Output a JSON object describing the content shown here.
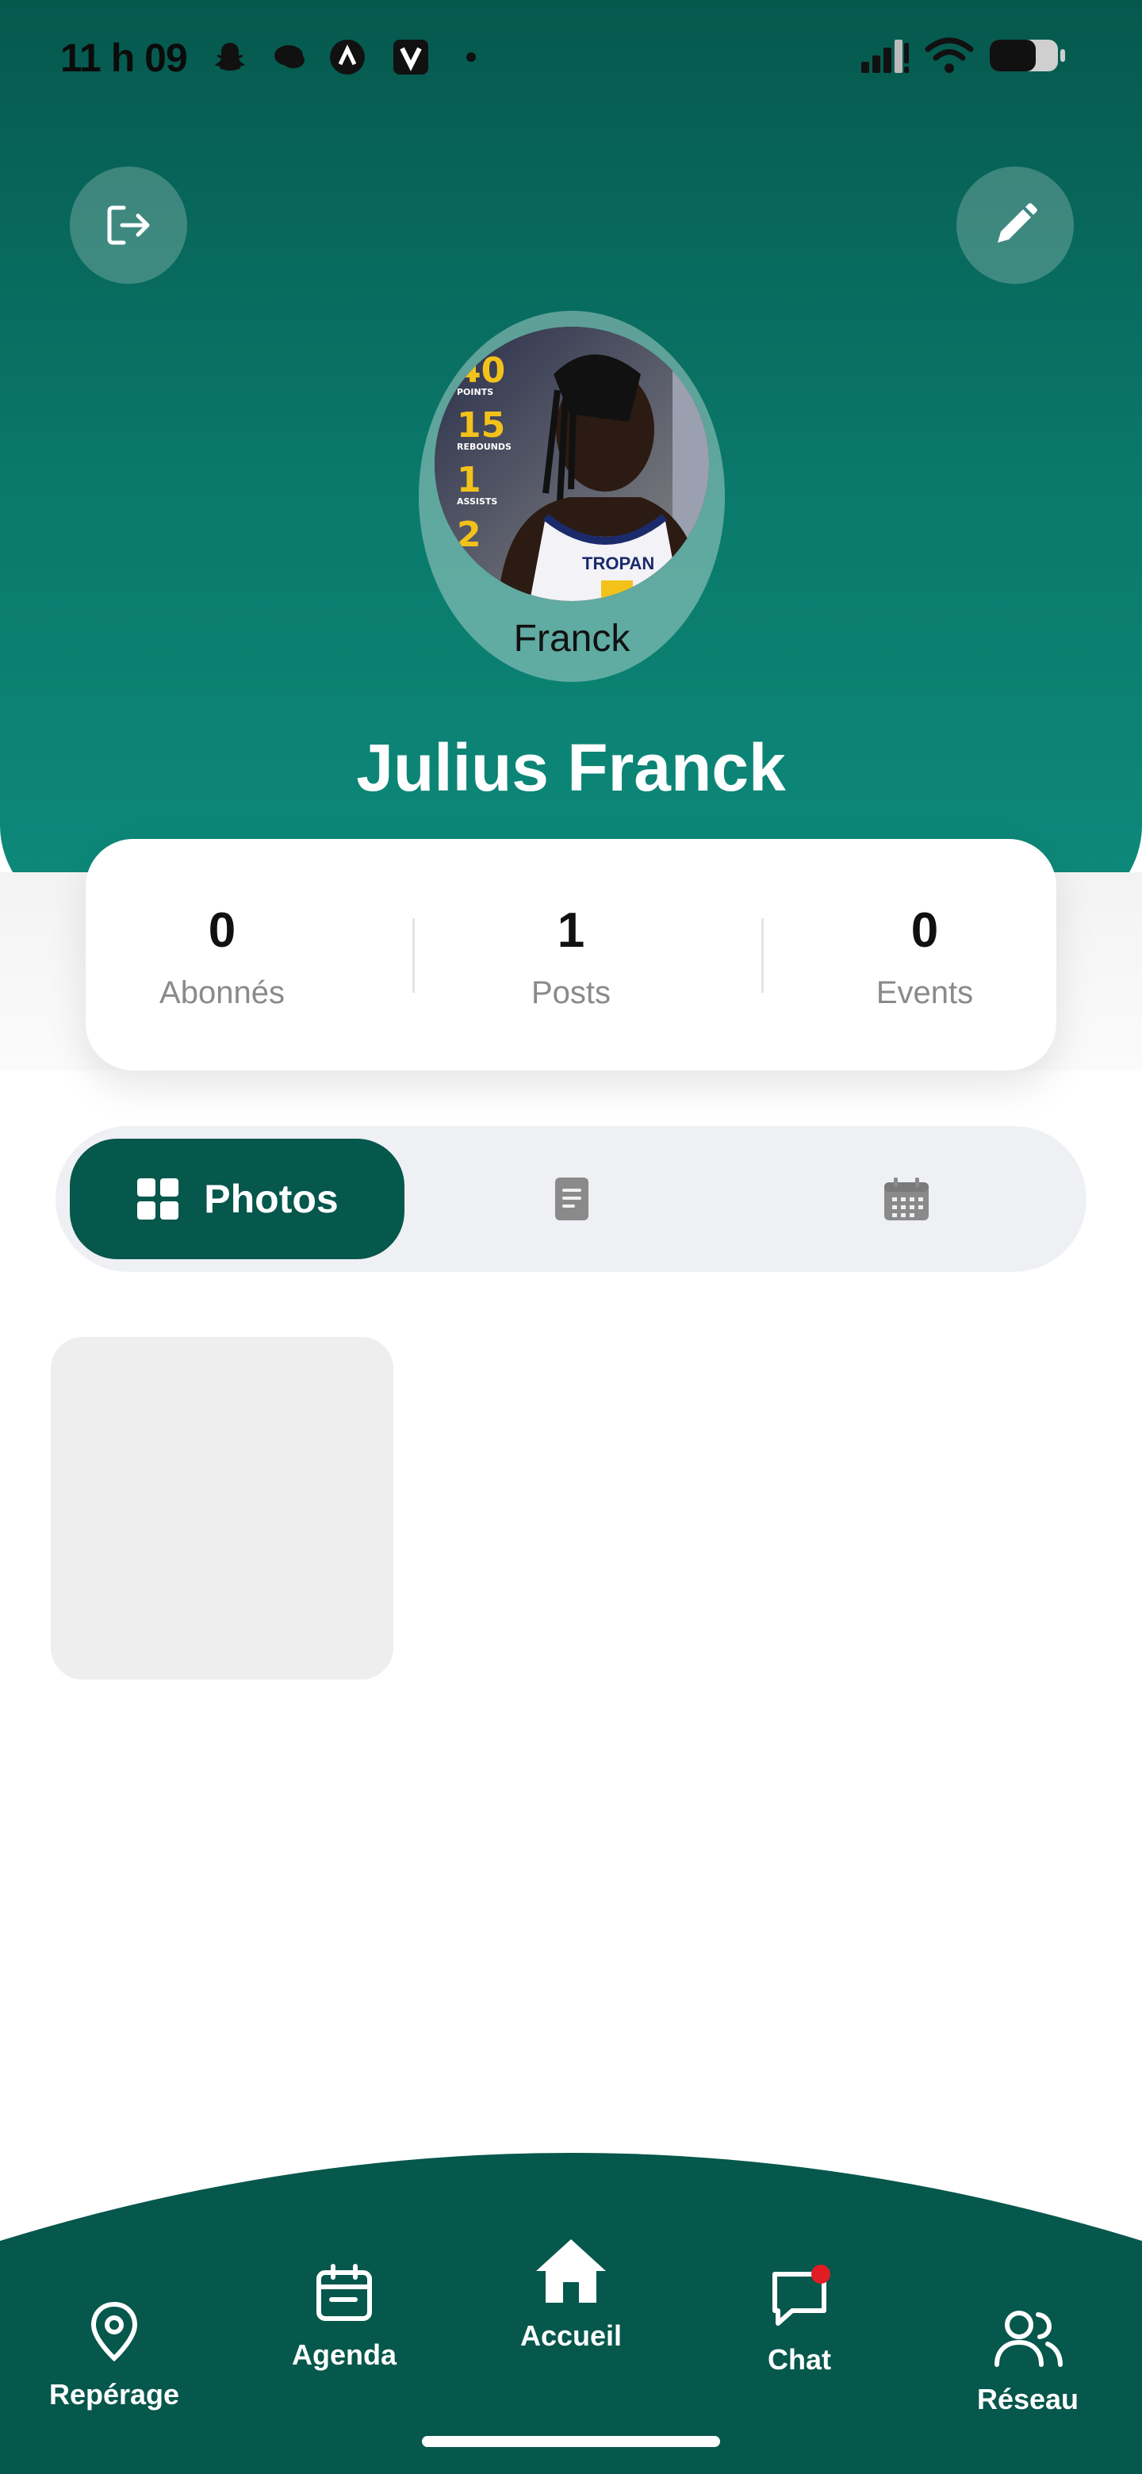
{
  "status_bar": {
    "time": "11 h 09"
  },
  "header": {
    "logout_icon": "logout-icon",
    "edit_icon": "edit-pencil-icon",
    "avatar_caption": "Franck",
    "profile_name": "Julius Franck",
    "avatar_card_stats": [
      "40",
      "15",
      "1",
      "2"
    ],
    "avatar_card_stat_labels": [
      "POINTS",
      "REBOUNDS",
      "ASSISTS"
    ],
    "jersey_text": "TROPAN"
  },
  "stats": [
    {
      "value": "0",
      "label": "Abonnés"
    },
    {
      "value": "1",
      "label": "Posts"
    },
    {
      "value": "0",
      "label": "Events"
    }
  ],
  "tabs": {
    "active_label": "Photos",
    "items": [
      "grid-icon",
      "document-icon",
      "calendar-icon"
    ]
  },
  "bottom_nav": {
    "items": [
      {
        "label": "Repérage",
        "icon": "location-pin-icon"
      },
      {
        "label": "Agenda",
        "icon": "calendar-icon"
      },
      {
        "label": "Accueil",
        "icon": "home-icon"
      },
      {
        "label": "Chat",
        "icon": "chat-icon"
      },
      {
        "label": "Réseau",
        "icon": "people-icon"
      }
    ]
  },
  "colors": {
    "primary": "#06574c",
    "header_end": "#0d8a7b",
    "badge": "#e11d24"
  }
}
